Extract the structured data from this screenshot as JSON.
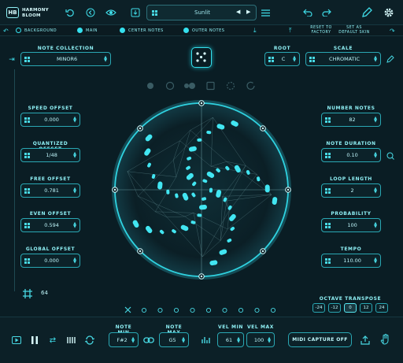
{
  "app": {
    "logo_mark": "HB",
    "name_line1": "HARMONY",
    "name_line2": "BLOOM"
  },
  "header": {
    "preset_name": "Sunlit"
  },
  "subbar": {
    "background_label": "BACKGROUND",
    "main_label": "MAIN",
    "center_notes_label": "CENTER NOTES",
    "outer_notes_label": "OUTER NOTES",
    "reset_label": "RESET TO FACTORY",
    "default_skin_label": "SET AS DEFAULT SKIN"
  },
  "left": {
    "note_collection": {
      "label": "NOTE COLLECTION",
      "value": "MINOR6"
    },
    "speed_offset": {
      "label": "SPEED OFFSET",
      "value": "0.000"
    },
    "quantized_offset": {
      "label": "QUANTIZED OFFSET",
      "value": "1/48"
    },
    "free_offset": {
      "label": "FREE OFFSET",
      "value": "0.781"
    },
    "even_offset": {
      "label": "EVEN OFFSET",
      "value": "0.594"
    },
    "global_offset": {
      "label": "GLOBAL OFFSET",
      "value": "0.000"
    },
    "grid_count": "64"
  },
  "right": {
    "root": {
      "label": "ROOT",
      "value": "C"
    },
    "scale": {
      "label": "SCALE",
      "value": "CHROMATIC"
    },
    "number_notes": {
      "label": "NUMBER NOTES",
      "value": "82"
    },
    "note_duration": {
      "label": "NOTE DURATION",
      "value": "0.10"
    },
    "loop_length": {
      "label": "LOOP LENGTH",
      "value": "2"
    },
    "probability": {
      "label": "PROBABILITY",
      "value": "100"
    },
    "tempo": {
      "label": "TEMPO",
      "value": "110.00"
    },
    "octave_transpose": {
      "label": "OCTAVE TRANSPOSE",
      "options": [
        "-24",
        "-12",
        "0",
        "12",
        "24"
      ],
      "selected": "0"
    }
  },
  "bottom": {
    "note_min": {
      "label": "NOTE MIN",
      "value": "F#2"
    },
    "note_max": {
      "label": "NOTE MAX",
      "value": "G5"
    },
    "vel_min": {
      "label": "VEL MIN",
      "value": "61"
    },
    "vel_max": {
      "label": "VEL MAX",
      "value": "100"
    },
    "midi_capture": "MIDI CAPTURE OFF"
  },
  "colors": {
    "accent": "#35e0ee",
    "background": "#0a1d24",
    "panel": "#0c2027"
  },
  "icons": [
    "undo-icon",
    "redo-icon",
    "eye-icon",
    "save-icon",
    "menu-icon",
    "dice-icon",
    "pencil-icon",
    "gear-icon",
    "play-icon",
    "pause-icon",
    "shuffle-icon",
    "piano-icon",
    "loop-icon",
    "link-icon",
    "export-icon",
    "hand-icon"
  ]
}
